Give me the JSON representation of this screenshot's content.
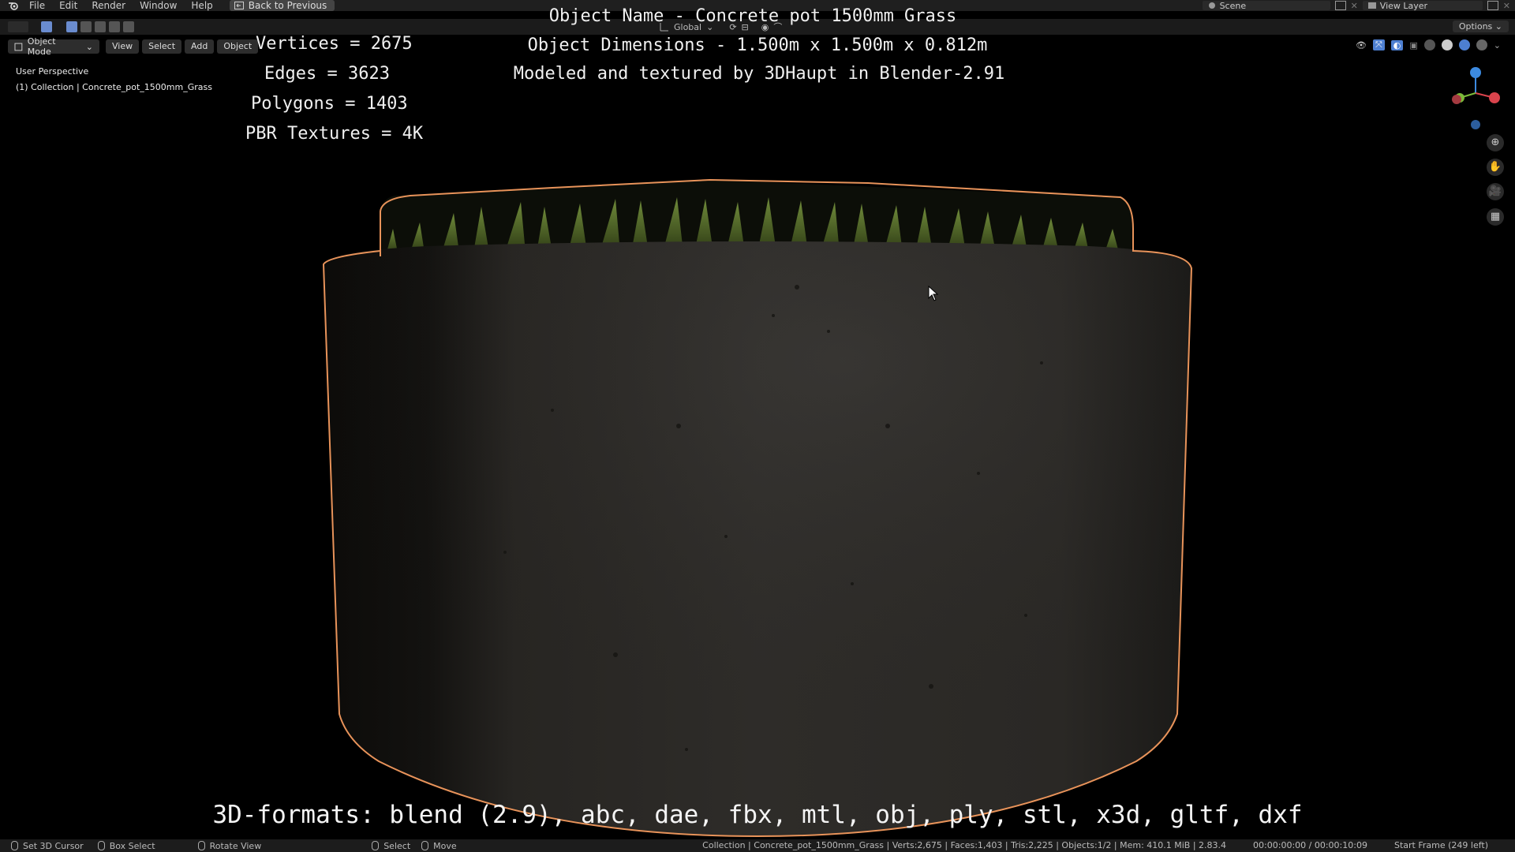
{
  "menubar": {
    "items": [
      "File",
      "Edit",
      "Render",
      "Window",
      "Help"
    ],
    "back_button": "Back to Previous",
    "scene": "Scene",
    "view_layer": "View Layer"
  },
  "toolbar": {
    "transform_orientation": "Global",
    "options": "Options"
  },
  "viewport_header": {
    "mode": "Object Mode",
    "menus": [
      "View",
      "Select",
      "Add",
      "Object"
    ]
  },
  "viewport": {
    "perspective": "User Perspective",
    "collection": "(1) Collection | Concrete_pot_1500mm_Grass"
  },
  "overlay": {
    "vertices": "Vertices = 2675",
    "edges": "Edges = 3623",
    "polygons": "Polygons = 1403",
    "textures": "PBR Textures = 4K",
    "object_name": "Object Name - Concrete pot 1500mm Grass",
    "dimensions": "Object Dimensions -  1.500m x 1.500m x 0.812m",
    "credit": "Modeled and textured by 3DHaupt in Blender-2.91",
    "formats": "3D-formats: blend (2.9), abc, dae, fbx, mtl, obj, ply, stl, x3d, gltf, dxf"
  },
  "statusbar": {
    "set_cursor": "Set 3D Cursor",
    "box_select": "Box Select",
    "rotate_view": "Rotate View",
    "select": "Select",
    "move": "Move",
    "scene_stats": "Collection | Concrete_pot_1500mm_Grass | Verts:2,675 | Faces:1,403 | Tris:2,225 | Objects:1/2 | Mem: 410.1 MiB | 2.83.4",
    "time": "00:00:00:00 / 00:00:10:09",
    "frame": "Start Frame (249 left)"
  },
  "colors": {
    "selection_outline": "#e8935a",
    "axis_x": "#d9434c",
    "axis_y": "#7cba3a",
    "axis_z": "#3c8ae0"
  }
}
